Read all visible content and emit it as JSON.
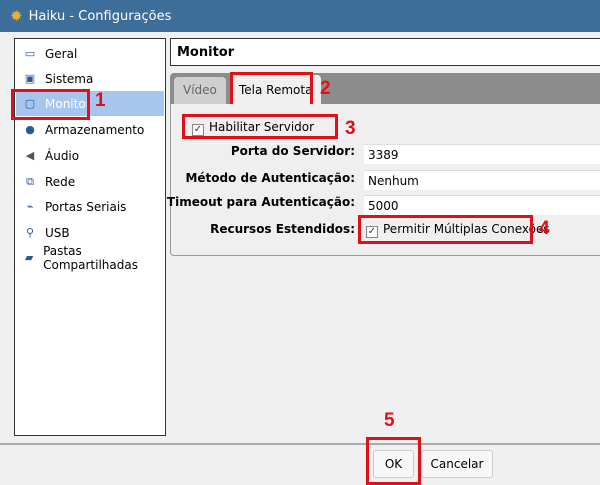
{
  "window": {
    "title": "Haiku - Configurações"
  },
  "sidebar": {
    "items": [
      {
        "label": "Geral",
        "icon": "monitor-computer-icon"
      },
      {
        "label": "Sistema",
        "icon": "chip-icon"
      },
      {
        "label": "Monitor",
        "icon": "display-icon",
        "selected": true
      },
      {
        "label": "Armazenamento",
        "icon": "disk-icon"
      },
      {
        "label": "Áudio",
        "icon": "speaker-icon"
      },
      {
        "label": "Rede",
        "icon": "network-icon"
      },
      {
        "label": "Portas Seriais",
        "icon": "serial-port-icon"
      },
      {
        "label": "USB",
        "icon": "usb-icon"
      },
      {
        "label": "Pastas Compartilhadas",
        "icon": "folder-icon"
      }
    ]
  },
  "main": {
    "header": "Monitor",
    "tabs": [
      {
        "label": "Vídeo"
      },
      {
        "label": "Tela Remota",
        "active": true
      }
    ],
    "enable_server": {
      "label": "Habilitar Servidor",
      "checked": true
    },
    "server_port": {
      "label": "Porta do Servidor:",
      "value": "3389"
    },
    "auth_method": {
      "label": "Método de Autenticação:",
      "value": "Nenhum"
    },
    "auth_timeout": {
      "label": "Timeout para Autenticação:",
      "value": "5000"
    },
    "extended": {
      "label": "Recursos Estendidos:",
      "option": "Permitir Múltiplas Conexões",
      "checked": true
    }
  },
  "buttons": {
    "ok": "OK",
    "cancel": "Cancelar"
  },
  "annotations": [
    "1",
    "2",
    "3",
    "4",
    "5"
  ],
  "colors": {
    "titlebar": "#3d6d99",
    "selection": "#a6c6ee",
    "annotation": "#e0101a"
  }
}
